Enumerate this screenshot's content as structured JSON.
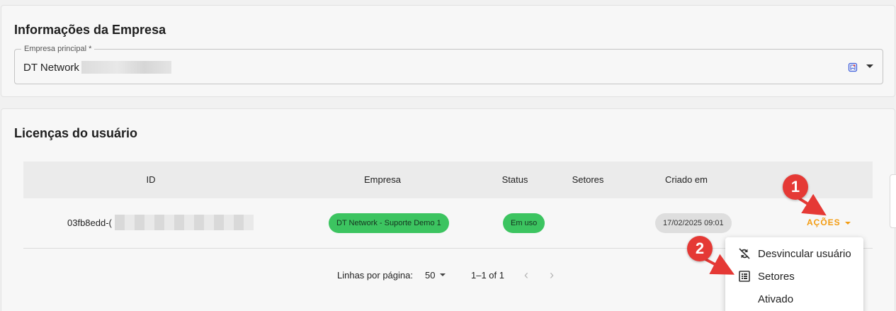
{
  "company_section": {
    "title": "Informações da Empresa",
    "field_label": "Empresa principal *",
    "field_value": "DT Network"
  },
  "licenses_section": {
    "title": "Licenças do usuário",
    "columns": [
      "ID",
      "Empresa",
      "Status",
      "Setores",
      "Criado em"
    ],
    "row": {
      "id": "03fb8edd-(",
      "empresa": "DT Network - Suporte Demo 1",
      "status": "Em uso",
      "setores": "",
      "criado_em": "17/02/2025 09:01",
      "actions_label": "AÇÕES"
    },
    "pagination": {
      "rows_label": "Linhas por página:",
      "rows_value": "50",
      "range": "1–1 of 1",
      "prev": "‹",
      "next": "›"
    }
  },
  "actions_menu": {
    "items": [
      {
        "label": "Desvincular usuário",
        "icon": "unlink-icon"
      },
      {
        "label": "Setores",
        "icon": "list-icon"
      },
      {
        "label": "Ativado",
        "icon": "toggle-on-icon"
      }
    ]
  },
  "annotations": {
    "badge_1": "1",
    "badge_2": "2",
    "color": "#e53935"
  },
  "colors": {
    "accent": "#f39c12",
    "success": "#3cc460"
  }
}
